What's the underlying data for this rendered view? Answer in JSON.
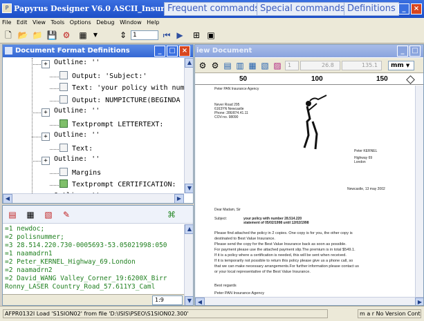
{
  "app": {
    "title": "Papyrus Designer V6.0 ASCII_InsuranceCon",
    "tags": [
      "Frequent commands",
      "Special commands",
      "Definitions"
    ]
  },
  "menu": [
    "File",
    "Edit",
    "View",
    "Tools",
    "Options",
    "Debug",
    "Window",
    "Help"
  ],
  "toolbar": {
    "page_field": "1"
  },
  "left_panel": {
    "title": "Document Format Definitions",
    "tree": [
      {
        "text": "Outline: ''",
        "icon": "plus",
        "indent": 1
      },
      {
        "text": "Output: 'Subject:'",
        "icon": "text",
        "indent": 2
      },
      {
        "text": "Text: 'your policy with number",
        "icon": "text",
        "indent": 2
      },
      {
        "text": "Output: NUMPICTURE(BEGINDA",
        "icon": "text",
        "indent": 2
      },
      {
        "text": "Outline: ''",
        "icon": "plus",
        "indent": 1
      },
      {
        "text": "Textprompt LETTERTEXT:",
        "icon": "green",
        "indent": 2
      },
      {
        "text": "Outline: ''",
        "icon": "plus",
        "indent": 1
      },
      {
        "text": "Text:",
        "icon": "text",
        "indent": 2
      },
      {
        "text": "Outline: ''",
        "icon": "plus",
        "indent": 1
      },
      {
        "text": "Margins",
        "icon": "margins",
        "indent": 2
      },
      {
        "text": "Textprompt CERTIFICATION:",
        "icon": "green",
        "indent": 2
      },
      {
        "text": "Outline: ''",
        "icon": "plus",
        "indent": 1
      }
    ]
  },
  "code_panel": {
    "lines": [
      "=1 newdoc;",
      "=2 polisnummer;",
      "=3 28.514.220.730-0005693-53.05021998:050",
      "=1 naamadrn1",
      "=2 Peter_KERNEL_Highway_69.London",
      "=2 naamadrn2",
      "=2 David_WANG Valley_Corner_19:6200X_Birr",
      " Ronny_LASER Country_Road_57.611Y3_Caml"
    ],
    "position": "1:9"
  },
  "doc_panel": {
    "title": "iew Document",
    "field1": "1",
    "field2": "26.8",
    "field3": "135.1",
    "unit": "mm",
    "ruler": [
      "50",
      "100",
      "150"
    ],
    "company": "Peter PAN Insurance Agency",
    "sender_address": [
      "Never Road 295",
      "6163YN Newcastle",
      "Phone: 286/874.41.11",
      "COV-no. 98090"
    ],
    "recipient": [
      "Peter KERNEL",
      "Highway 69",
      "London"
    ],
    "date_line": "Newcastle, 13 may 2002",
    "salutation": "Dear Madam, Sir",
    "subject_label": "Subject:",
    "subject_text": [
      "your policy with number 28.514.220",
      "statement of 05/02/1998 until 12/02/1998"
    ],
    "body": [
      "Please find attached the policy in 2 copies. One copy is for you, the other copy is",
      "destinated to Best Value Insurance.",
      "Please send the copy for the Best Value Insurance back as soon as possible.",
      "For payment please use the attached payment slip.The premium is in total $549.1.",
      "If it is a policy  where a certification is needed, this will be sent when received.",
      "If it is temporarily not possible to return this policy  please give us a phone call, so",
      "that we can make necessary arrangements.For further information please contact us",
      "or your local representative of the Best Value Insurance."
    ],
    "closing": "Best regards",
    "signature": "Peter PAN Insurance Agency"
  },
  "status": {
    "message": "AFPR0132I Load 'S1SION02' from file 'D:\\ISIS\\PSEO\\S1SION02.300'",
    "right": "m a r No Version Control"
  },
  "colors": {
    "title_blue": "#1d4fc8",
    "code_green": "#208020",
    "tag_text": "#3a5bbf"
  }
}
